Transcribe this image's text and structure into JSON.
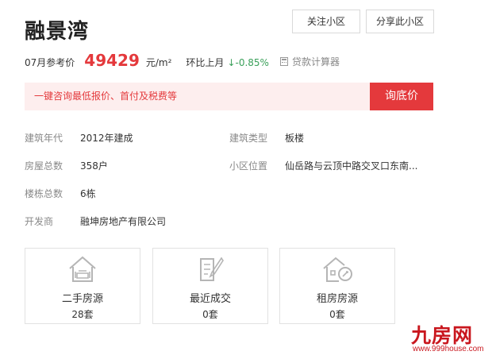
{
  "community": {
    "name": "融景湾"
  },
  "actions": {
    "follow_label": "关注小区",
    "share_label": "分享此小区"
  },
  "price": {
    "label": "07月参考价",
    "value": "49429",
    "unit": "元/m²",
    "mom_label": "环比上月",
    "mom_value": "↓-0.85%",
    "calculator_label": "贷款计算器"
  },
  "consult": {
    "text": "一键咨询最低报价、首付及税费等",
    "button": "询底价"
  },
  "info": {
    "build_year": {
      "label": "建筑年代",
      "value": "2012年建成"
    },
    "build_type": {
      "label": "建筑类型",
      "value": "板楼"
    },
    "households": {
      "label": "房屋总数",
      "value": "358户"
    },
    "location": {
      "label": "小区位置",
      "value": "仙岳路与云顶中路交叉口东南..."
    },
    "buildings": {
      "label": "楼栋总数",
      "value": "6栋"
    },
    "developer": {
      "label": "开发商",
      "value": "融坤房地产有限公司"
    }
  },
  "cards": [
    {
      "title": "二手房源",
      "count": "28套",
      "icon": "house-sofa-icon"
    },
    {
      "title": "最近成交",
      "count": "0套",
      "icon": "document-pen-icon"
    },
    {
      "title": "租房房源",
      "count": "0套",
      "icon": "house-key-icon"
    }
  ],
  "watermark": {
    "name": "九房网",
    "url": "www.999house.com"
  },
  "colors": {
    "accent": "#e4393c",
    "consult_bg": "#fdeeee",
    "down": "#3aa05a"
  }
}
